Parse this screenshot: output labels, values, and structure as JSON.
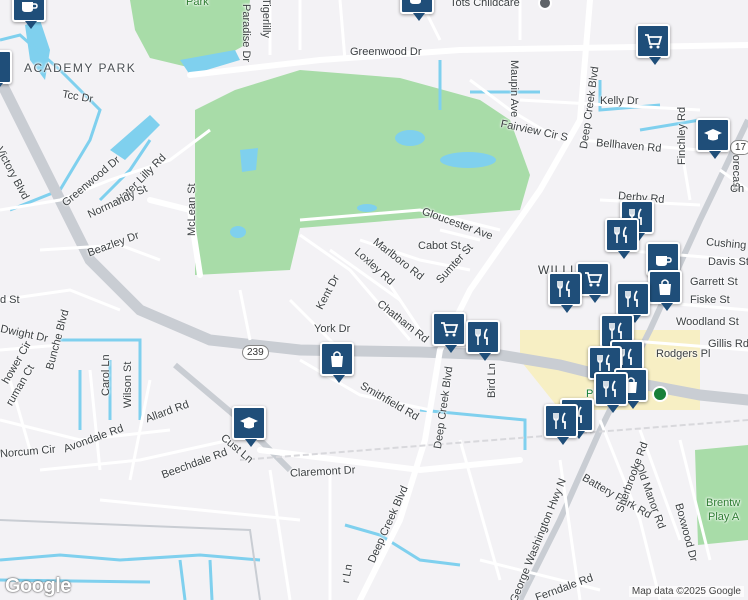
{
  "labels": {
    "park_top": "Park",
    "tigerlilly": "Tigerlilly",
    "paradise": "Paradise Dr",
    "tots": "Tots Childcare",
    "greenwood_top": "Greenwood Dr",
    "academy_park": "ACADEMY PARK",
    "tcc": "Tcc Dr",
    "victory": "Victory Blvd",
    "greenwood_left": "Greenwood Dr",
    "water_lilly": "Water Lilly Rd",
    "normandy": "Normandy St",
    "mclean": "McLean St",
    "beazley": "Beazley Dr",
    "maupin": "Maupin Ave",
    "deep_creek_top": "Deep Creek Blvd",
    "kelly": "Kelly Dr",
    "fairview": "Fairview Cir S",
    "bellhaven": "Bellhaven Rd",
    "finchley": "Finchley Rd",
    "forecast": "Forecast",
    "gloucester": "Gloucester Ave",
    "cabot": "Cabot St",
    "marlboro": "Marlboro Rd",
    "sumter": "Sumter St",
    "loxley": "Loxley Rd",
    "derby": "Derby Rd",
    "cushing": "Cushing",
    "davis": "Davis St",
    "garrett": "Garrett St",
    "fiske": "Fiske St",
    "woodland": "Woodland St",
    "gillis": "Gillis Rd",
    "rodgers": "Rodgers Pl",
    "chatham": "Chatham Rd",
    "kent": "Kent Dr",
    "york": "York Dr",
    "st_left": "d St",
    "dwight": "Dwight Dr",
    "bunche": "Bunche Blvd",
    "hower": "hower Cir",
    "ruman": "ruman Ct",
    "carol": "Carol Ln",
    "wilson": "Wilson St",
    "allard": "Allard Rd",
    "norcum": "Norcum Cir",
    "avondale": "Avondale Rd",
    "beechdale": "Beechdale Rd",
    "cust": "Cust Ln",
    "smithfield": "Smithfield Rd",
    "deep_creek_mid": "Deep Creek Blvd",
    "bird": "Bird Ln",
    "claremont": "Claremont Dr",
    "deep_creek_bot": "Deep Creek Blvd",
    "george_washington": "George Washington Hwy N",
    "battery_park": "Battery Park Rd",
    "old_manor": "Old Manor Rd",
    "sherbrooke": "Sherbrooke Rd",
    "boxwood": "Boxwood Dr",
    "brentw": "Brentw",
    "play_a": "Play A",
    "ferndale": "Ferndale Rd",
    "willi": "WILLI",
    "plan": "Plan",
    "ch": "Ch",
    "r_ln": "r Ln"
  },
  "shields": {
    "route_239": "239",
    "route_17": "17"
  },
  "attribution": {
    "logo": "Google",
    "map_data": "Map data ©2025 Google"
  },
  "icons": {
    "restaurant": "fork-knife-icon",
    "shopping": "shopping-bag-icon",
    "grocery": "shopping-cart-icon",
    "school": "graduation-cap-icon",
    "cafe": "coffee-cup-icon"
  },
  "colors": {
    "park": "#a8dca8",
    "water": "#7fd0ee",
    "road": "#ffffff",
    "highway": "#c9cdd3",
    "marker": "#1f4e79",
    "commercial": "#f7efc4"
  }
}
